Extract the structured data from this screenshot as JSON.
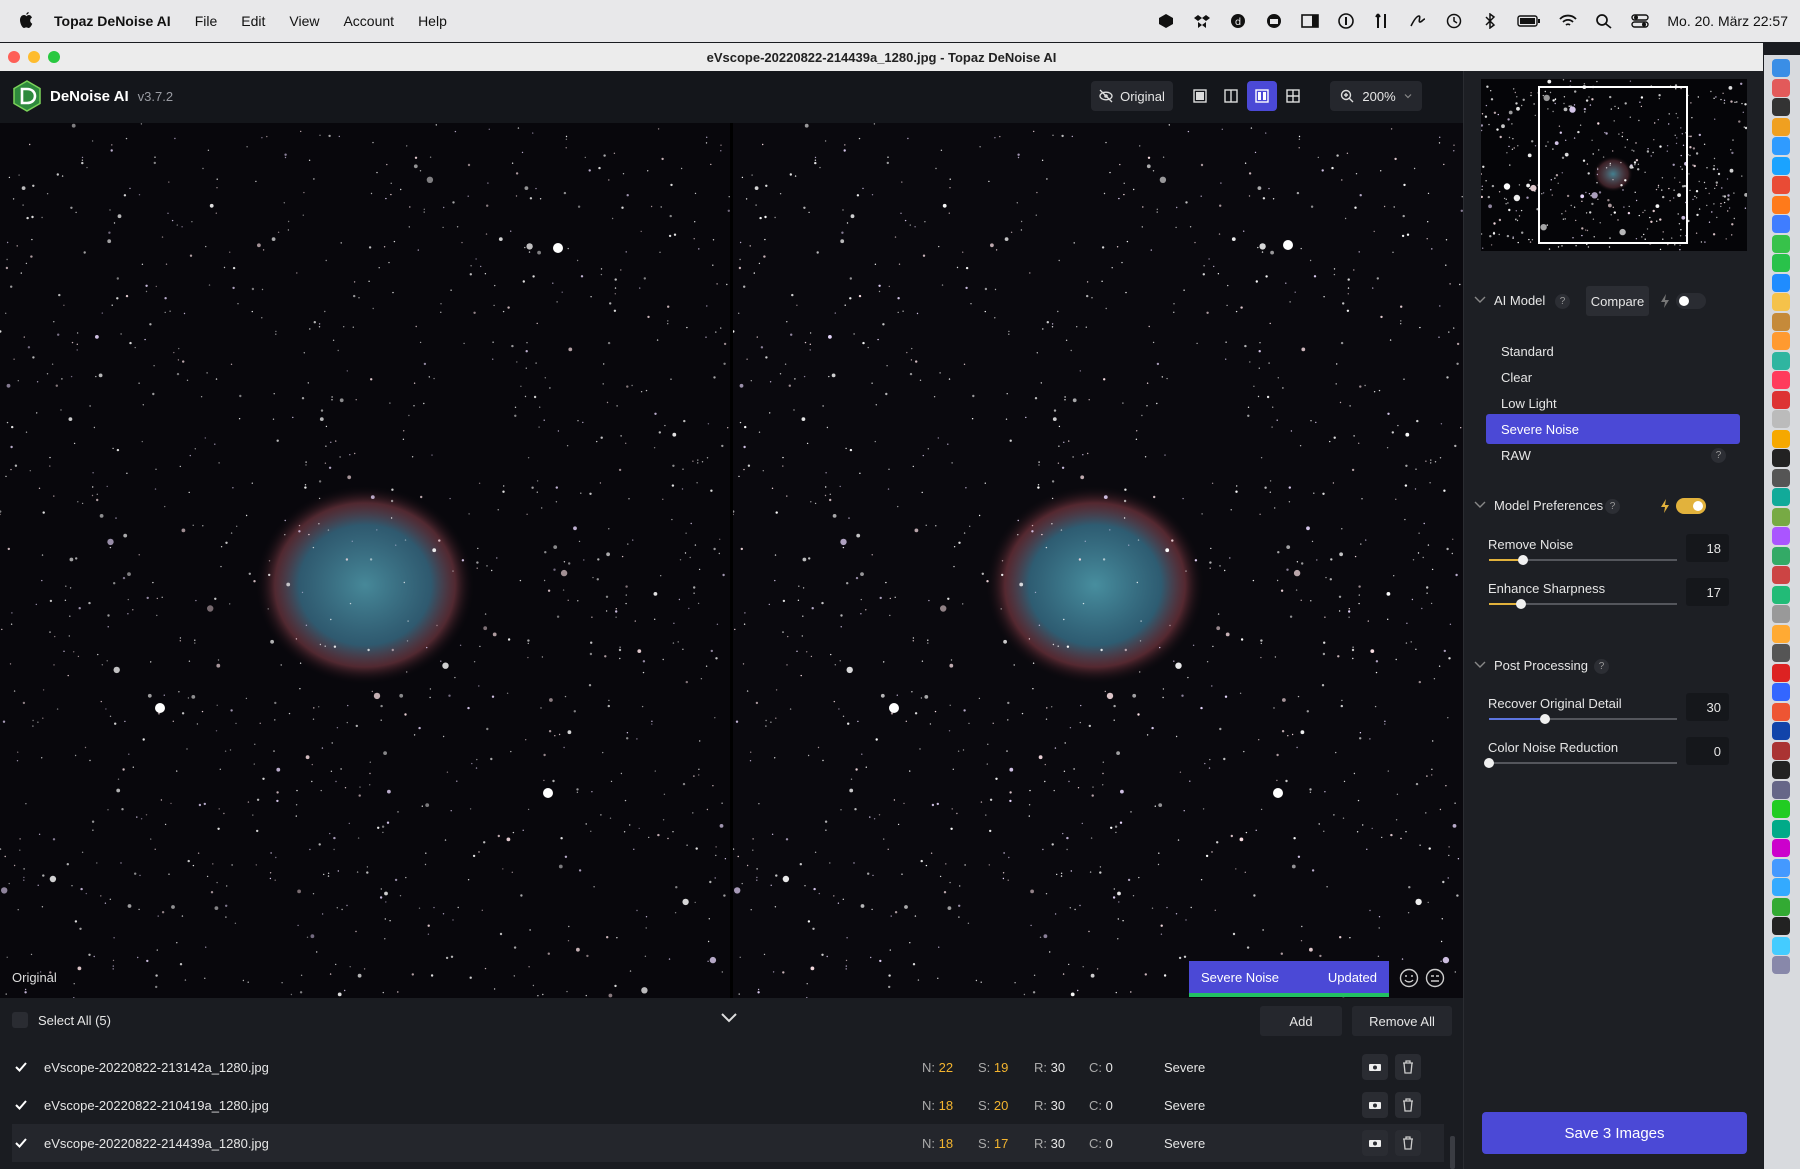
{
  "menubar": {
    "app_name": "Topaz DeNoise AI",
    "items": [
      "File",
      "Edit",
      "View",
      "Account",
      "Help"
    ],
    "datetime": "Mo. 20. März  22:57"
  },
  "window": {
    "title": "eVscope-20220822-214439a_1280.jpg - Topaz DeNoise AI"
  },
  "toolbar": {
    "app_name": "DeNoise AI",
    "version": "v3.7.2",
    "original_label": "Original",
    "zoom": "200%"
  },
  "viewer": {
    "left_label": "Original",
    "model_badge": "Severe Noise",
    "status_badge": "Updated"
  },
  "filelist": {
    "select_all": "Select All (5)",
    "add_label": "Add",
    "remove_all_label": "Remove All",
    "files": [
      {
        "name": "eVscope-20220822-213142a_1280.jpg",
        "N": "22",
        "S": "19",
        "R": "30",
        "C": "0",
        "model": "Severe"
      },
      {
        "name": "eVscope-20220822-210419a_1280.jpg",
        "N": "18",
        "S": "20",
        "R": "30",
        "C": "0",
        "model": "Severe"
      },
      {
        "name": "eVscope-20220822-214439a_1280.jpg",
        "N": "18",
        "S": "17",
        "R": "30",
        "C": "0",
        "model": "Severe"
      }
    ],
    "labels": {
      "n": "N:",
      "s": "S:",
      "r": "R:",
      "c": "C:"
    }
  },
  "sidebar": {
    "ai_model": {
      "title": "AI Model",
      "compare_label": "Compare",
      "models": [
        "Standard",
        "Clear",
        "Low Light",
        "Severe Noise",
        "RAW"
      ],
      "selected": "Severe Noise"
    },
    "model_preferences": {
      "title": "Model Preferences",
      "remove_noise": {
        "label": "Remove Noise",
        "value": "18",
        "fraction": 0.18
      },
      "enhance_sharpness": {
        "label": "Enhance Sharpness",
        "value": "17",
        "fraction": 0.17
      }
    },
    "post_processing": {
      "title": "Post Processing",
      "recover_detail": {
        "label": "Recover Original Detail",
        "value": "30",
        "fraction": 0.3
      },
      "color_noise": {
        "label": "Color Noise Reduction",
        "value": "0",
        "fraction": 0
      }
    },
    "save_label": "Save 3 Images"
  },
  "colors": {
    "accent": "#4b49d6",
    "highlight": "#f3b42f",
    "updated_bar": "#22c063"
  }
}
